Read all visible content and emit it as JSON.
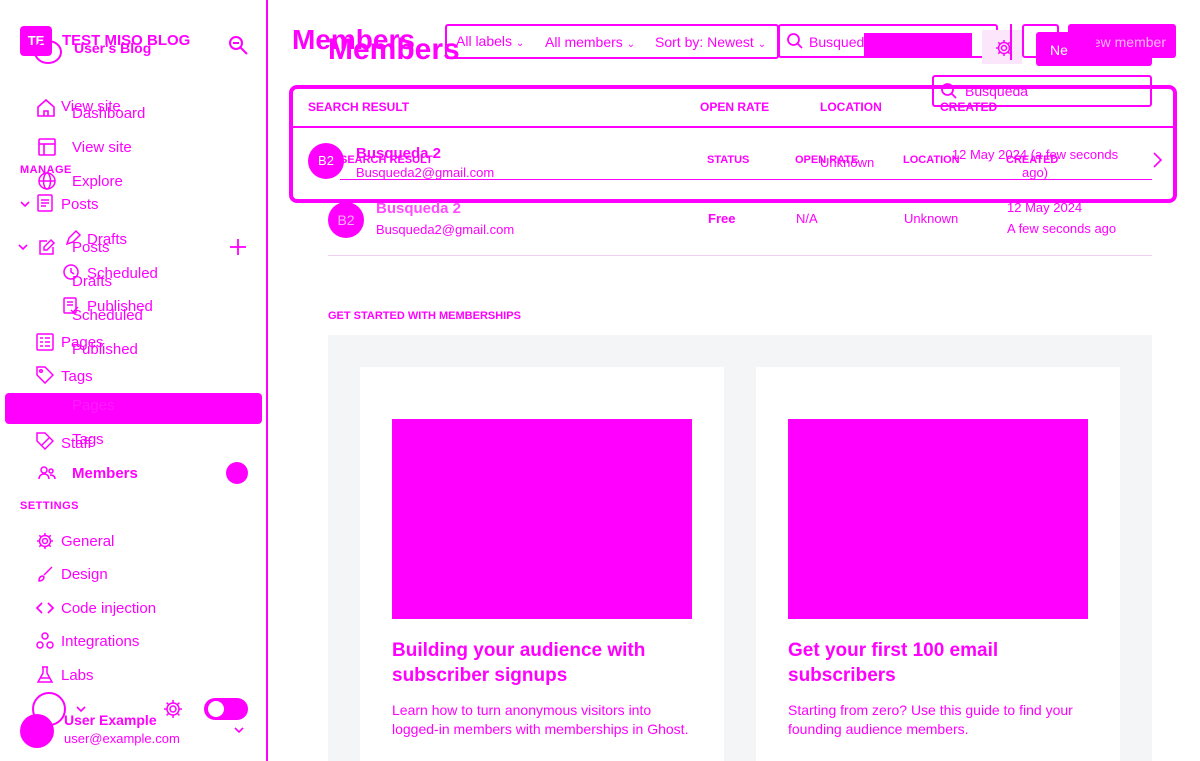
{
  "sidebar": {
    "blog_initials": "TE",
    "blog_title": "TEST MISO BLOG",
    "blog_subtitle": "User's Blog",
    "nav_top": [
      {
        "label": "View site"
      },
      {
        "label": "Dashboard"
      },
      {
        "label": "View site"
      },
      {
        "label": "Explore"
      }
    ],
    "manage_label": "MANAGE",
    "posts_label": "Posts",
    "posts_label_2": "Posts",
    "drafts_label": "Drafts",
    "drafts_label_2": "Drafts",
    "scheduled_label": "Scheduled",
    "scheduled_label_2": "Scheduled",
    "published_label": "Published",
    "published_label_2": "Published",
    "pages_label": "Pages",
    "tags_label": "Tags",
    "tags_label_2": "Tags",
    "pages_label_2": "Pages",
    "staff_label": "Staff",
    "members_label": "Members",
    "settings_label": "SETTINGS",
    "settings_items": [
      {
        "label": "General"
      },
      {
        "label": "Design"
      },
      {
        "label": "Code injection"
      },
      {
        "label": "Integrations"
      },
      {
        "label": "Labs"
      }
    ],
    "user_name": "User Example",
    "user_email": "user@example.com"
  },
  "header": {
    "title": "Members",
    "title_shadow": "Members",
    "filters": {
      "labels": "All labels",
      "members": "All members",
      "sort": "Sort by: Newest"
    },
    "search_value": "Busqueda",
    "search_value_dropdown": "Busqueda",
    "new_member_short": "Ne",
    "new_member_label": "New member"
  },
  "table": {
    "headers_overlay": {
      "search_result": "SEARCH RESULT",
      "open_rate": "OPEN RATE",
      "location": "LOCATION",
      "created": "CREATED"
    },
    "headers_under": {
      "search_result": "SEARCH RESULT",
      "status": "STATUS",
      "open_rate": "OPEN RATE",
      "location": "LOCATION",
      "created": "CREATED"
    },
    "overlay_row": {
      "initials": "B2",
      "name": "Busqueda 2",
      "email": "Busqueda2@gmail.com",
      "location": "Unknown",
      "created": "12 May 2024 (a few seconds ago)"
    },
    "row": {
      "initials": "B2",
      "name": "Busqueda 2",
      "email": "Busqueda2@gmail.com",
      "status": "Free",
      "open_rate": "N/A",
      "location": "Unknown",
      "created_date": "12 May 2024",
      "created_relative": "A few seconds ago"
    }
  },
  "get_started": {
    "heading": "GET STARTED WITH MEMBERSHIPS",
    "cards": [
      {
        "title": "Building your audience with subscriber signups",
        "desc": "Learn how to turn anonymous visitors into logged-in members with memberships in Ghost."
      },
      {
        "title": "Get your first 100 email subscribers",
        "desc": "Starting from zero? Use this guide to find your founding audience members."
      }
    ]
  },
  "colors": {
    "accent": "#ff00ff",
    "panel_bg": "#f4f5f6",
    "background": "#ffffff"
  }
}
